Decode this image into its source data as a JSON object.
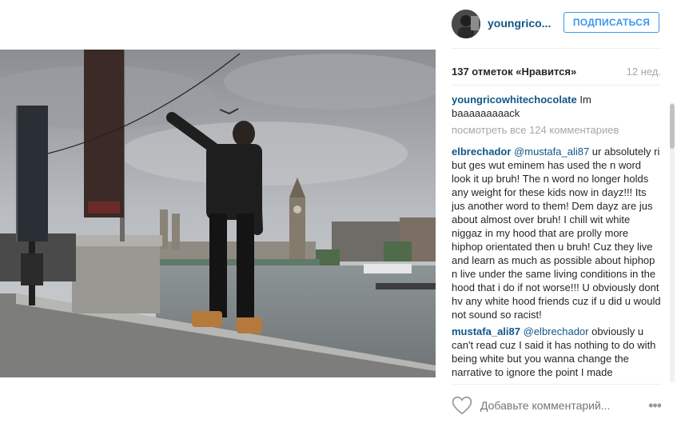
{
  "post": {
    "username": "youngrico...",
    "follow_label": "ПОДПИСАТЬСЯ",
    "likes": "137 отметок «Нравится»",
    "time": "12 нед."
  },
  "caption": {
    "user": "youngricowhitechocolate",
    "text": " Im baaaaaaaaack"
  },
  "view_all": "посмотреть все 124 комментариев",
  "comments": [
    {
      "user": "elbrechador",
      "mention": "@mustafa_ali87",
      "text": " ur absolutely ri but ges wut eminem has used the n word look it up bruh! The n word no longer holds any weight for these kids now in dayz!!! Its jus another word to them! Dem dayz are jus about almost over bruh! I chill wit white niggaz in my hood that are prolly more hiphop orientated then u bruh! Cuz they live and learn as much as possible about hiphop n live under the same living conditions in the hood that i do if not worse!!! U obviously dont hv any white hood friends cuz if u did u would not sound so racist!"
    },
    {
      "user": "mustafa_ali87",
      "mention": "@elbrechador",
      "text": " obviously u can't read cuz I said it has nothing to do with being white but you wanna change the narrative to ignore the point I made"
    }
  ],
  "add_comment_placeholder": "Добавьте комментарий...",
  "more_glyph": "•••",
  "icons": {
    "like": "heart-outline-icon",
    "more": "more-options-icon"
  },
  "colors": {
    "link": "#125688",
    "follow": "#3897f0",
    "muted": "#a5a7aa"
  }
}
